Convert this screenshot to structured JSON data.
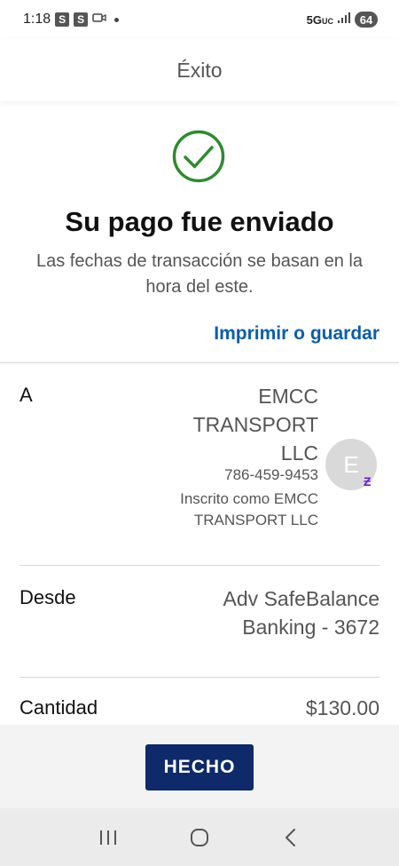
{
  "status_bar": {
    "time": "1:18",
    "badge1": "S",
    "badge2": "S",
    "network": "5G",
    "network_sub": "UC",
    "battery": "64"
  },
  "header": {
    "title": "Éxito"
  },
  "confirmation": {
    "title": "Su pago fue enviado",
    "subtitle": "Las fechas de transacción se basan en la hora del este.",
    "print_link": "Imprimir o guardar"
  },
  "details": {
    "to_label": "A",
    "payee_name": "EMCC TRANSPORT LLC",
    "payee_phone": "786-459-9453",
    "payee_registered": "Inscrito como EMCC TRANSPORT LLC",
    "avatar_initial": "E",
    "from_label": "Desde",
    "from_value": "Adv SafeBalance Banking - 3672",
    "amount_label": "Cantidad",
    "amount_value": "$130.00"
  },
  "actions": {
    "done_label": "HECHO"
  },
  "colors": {
    "success_green": "#2e8b2e",
    "link_blue": "#0b5ea8",
    "button_navy": "#0f2a6b",
    "zelle_purple": "#6d1ed4"
  },
  "icons": {
    "check": "check-circle-icon",
    "video": "video-icon",
    "signal": "signal-icon",
    "zelle": "zelle-icon",
    "recents": "recents-icon",
    "home": "home-icon",
    "back": "back-icon"
  }
}
